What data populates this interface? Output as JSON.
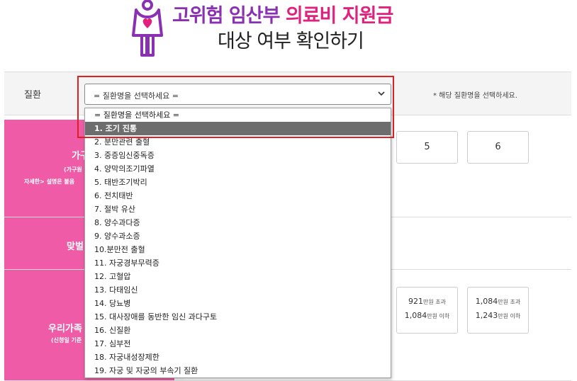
{
  "header": {
    "title_part1": "고위험 임산부",
    "title_part2": "의료비 지원금",
    "title_line2": "대상 여부 확인하기"
  },
  "colors": {
    "purple": "#8b2fb3",
    "pink": "#e0217e",
    "label_bg": "#ef5ba6",
    "highlight": "#e02020",
    "selected_option": "#6d6d6d"
  },
  "disease": {
    "label": "질환",
    "select_value": "= 질환명을 선택하세요 =",
    "note": "* 해당 질환명을 선택하세요."
  },
  "dropdown": {
    "options": [
      "= 질환명을 선택하세요 =",
      "1. 조기 진통",
      "2. 분만관련 출혈",
      "3. 중증임신중독증",
      "4. 양막의조기파열",
      "5. 태반조기박리",
      "6. 전치태반",
      "7. 절박 유산",
      "8. 양수과다증",
      "9. 양수과소증",
      "10.분만전 출혈",
      "11. 자궁경부무력증",
      "12. 고혈압",
      "13. 다태임신",
      "14. 당뇨병",
      "15. 대사장애를 동반한 임신 과다구토",
      "16. 신질환",
      "17. 심부전",
      "18. 자궁내성장제한",
      "19. 자궁 및 자궁의 부속기 질환"
    ],
    "selected_index": 1
  },
  "household": {
    "label_partial": "가구",
    "sub1_partial": "(가구원",
    "sub2_partial": "자세한> 설명은 붙음",
    "options": [
      "5",
      "6"
    ]
  },
  "dual_income": {
    "label_partial": "맞벌"
  },
  "income": {
    "label_partial": "우리가족",
    "sub_partial": "(신청일 기준",
    "options": [
      {
        "line1_amount": "921",
        "line1_unit": "만원 초과",
        "line2_amount": "1,084",
        "line2_unit": "만원 이하"
      },
      {
        "line1_amount": "1,084",
        "line1_unit": "만원 초과",
        "line2_amount": "1,243",
        "line2_unit": "만원 이하"
      }
    ]
  }
}
